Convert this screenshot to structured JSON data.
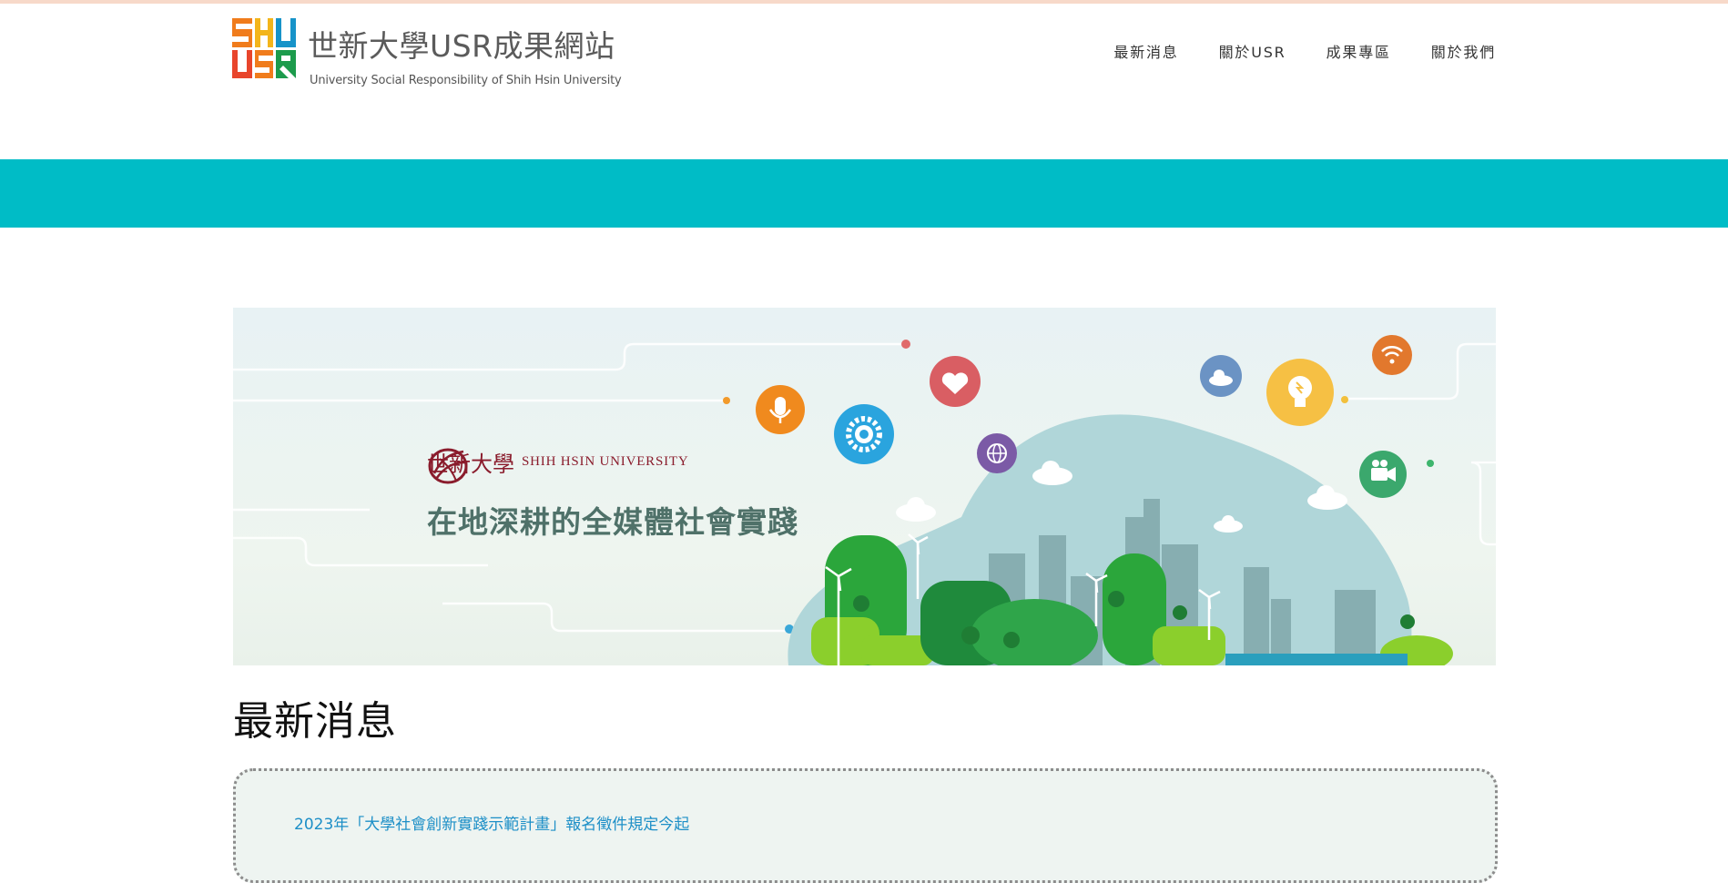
{
  "site": {
    "logo_letters": [
      "S",
      "H",
      "U",
      "U",
      "S",
      "R"
    ],
    "title": "世新大學USR成果網站",
    "subtitle": "University Social Responsibility of Shih Hsin University"
  },
  "nav": {
    "items": [
      {
        "label": "最新消息"
      },
      {
        "label": "關於USR"
      },
      {
        "label": "成果專區"
      },
      {
        "label": "關於我們"
      }
    ]
  },
  "banner": {
    "university_zh": "世新大學",
    "university_en": "SHIH HSIN UNIVERSITY",
    "slogan": "在地深耕的全媒體社會實踐",
    "icons": [
      "microphone-icon",
      "gear-icon",
      "heart-icon",
      "globe-icon",
      "cloud-icon",
      "lightbulb-icon",
      "wifi-icon",
      "video-camera-icon"
    ]
  },
  "news": {
    "heading": "最新消息",
    "first_item": "2023年「大學社會創新實踐示範計畫」報名徵件規定今起"
  },
  "colors": {
    "teal": "#00bcc6",
    "link": "#1d8fc7",
    "brand_orange": "#f07c1c",
    "brand_blue": "#1793c9",
    "brand_green": "#1c9b4c",
    "university_red": "#8a1c2c"
  }
}
